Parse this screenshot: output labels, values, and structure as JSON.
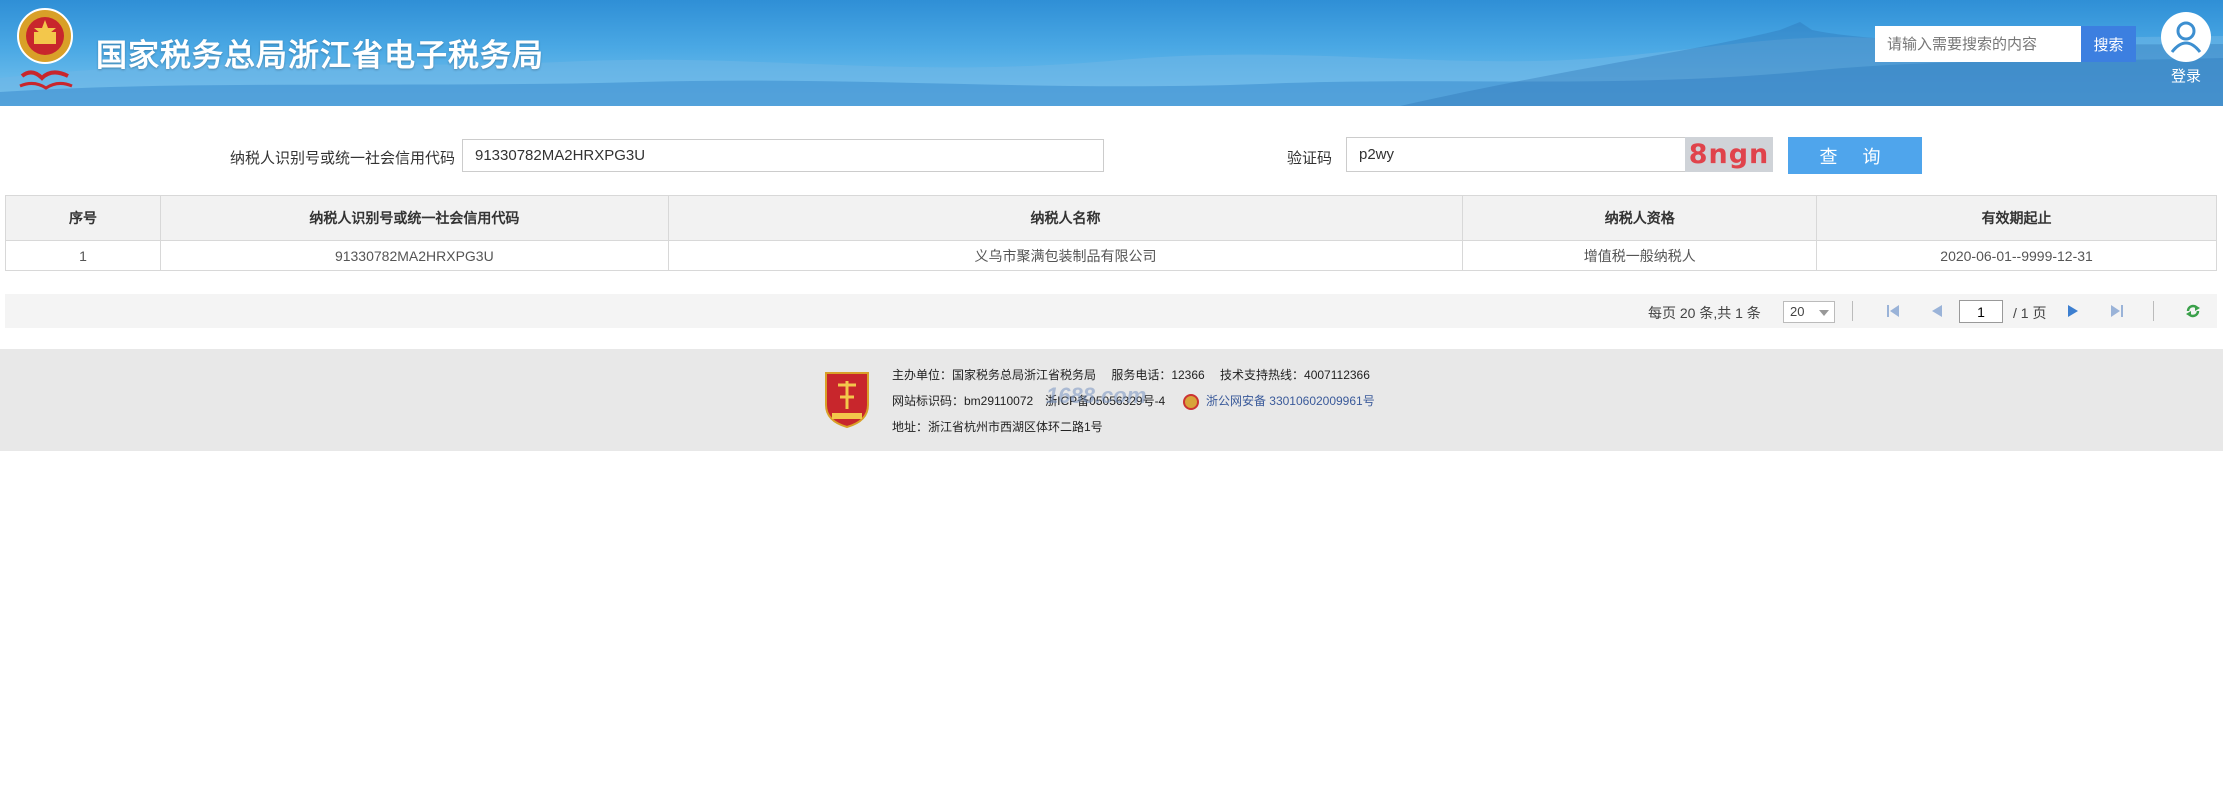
{
  "header": {
    "site_title": "国家税务总局浙江省电子税务局",
    "search_placeholder": "请输入需要搜索的内容",
    "search_button": "搜索",
    "login_label": "登录"
  },
  "query_form": {
    "tax_id_label": "纳税人识别号或统一社会信用代码",
    "tax_id_value": "91330782MA2HRXPG3U",
    "captcha_label": "验证码",
    "captcha_value": "p2wy",
    "captcha_image_text": "8ngn",
    "query_button": "查  询"
  },
  "table": {
    "columns": [
      "序号",
      "纳税人识别号或统一社会信用代码",
      "纳税人名称",
      "纳税人资格",
      "有效期起止"
    ],
    "rows": [
      [
        "1",
        "91330782MA2HRXPG3U",
        "义乌市聚满包装制品有限公司",
        "增值税一般纳税人",
        "2020-06-01--9999-12-31"
      ]
    ]
  },
  "pagination": {
    "info": "每页 20 条,共 1 条",
    "page_size": "20",
    "current_page": "1",
    "total_pages": "/ 1 页"
  },
  "footer": {
    "line1": "主办单位：国家税务总局浙江省税务局　 服务电话：12366　 技术支持热线：4007112366",
    "line2_prefix": "网站标识码：bm29110072　浙ICP备05056329号-4",
    "police_text": "浙公网安备 33010602009961号",
    "line3": "地址：浙江省杭州市西湖区体环二路1号",
    "watermark": "1688.com"
  },
  "colors": {
    "header_blue": "#2f8fd6",
    "button_blue": "#4fa5ec",
    "captcha_red": "#e0434b",
    "footer_bg": "#e8e8e8"
  }
}
